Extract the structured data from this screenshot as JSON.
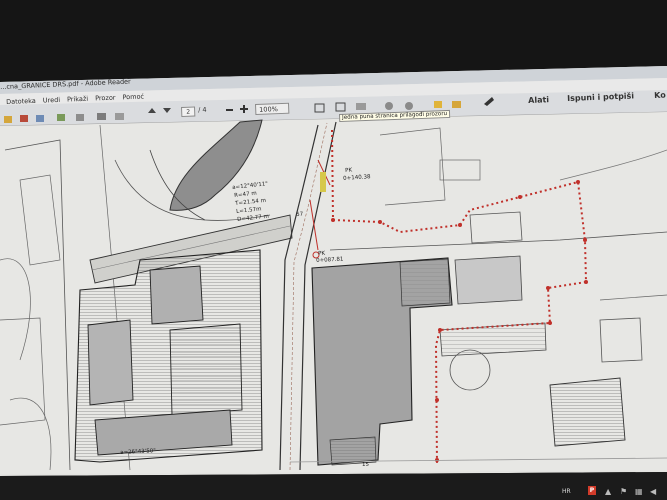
{
  "window": {
    "title": "...cna_GRANICE DRS.pdf - Adobe Reader"
  },
  "menu": [
    "Datoteka",
    "Uredi",
    "Prikaži",
    "Prozor",
    "Pomoć"
  ],
  "toolbar": {
    "page_current": "2",
    "page_total": "/ 4",
    "zoom": "100%",
    "tools_label": "Alati",
    "fill_sign_label": "Ispuni i potpiši",
    "comment_label": "Ko"
  },
  "tooltip": "Jedna puna stranica prilagođi prozoru",
  "map_labels": {
    "curve_data": [
      "a=12°40'11\"",
      "R=47 m",
      "T=21.54 m",
      "L=1.57m",
      "D=42.77 m"
    ],
    "point_pk1": "PK",
    "point_pk1_value": "0+140.38",
    "point_pk2": "PK",
    "point_pk2_value": "0+087.81",
    "bottom_label": "a=26°43'50\"",
    "station_label": "57"
  },
  "page_footer": "15",
  "tray": {
    "lang": "HR",
    "icon_label": "P"
  },
  "colors": {
    "paper": "#e7e7e4",
    "frame": "#141414",
    "boundary_red": "#c0302a",
    "hatch_gray": "#8d8d8d"
  }
}
